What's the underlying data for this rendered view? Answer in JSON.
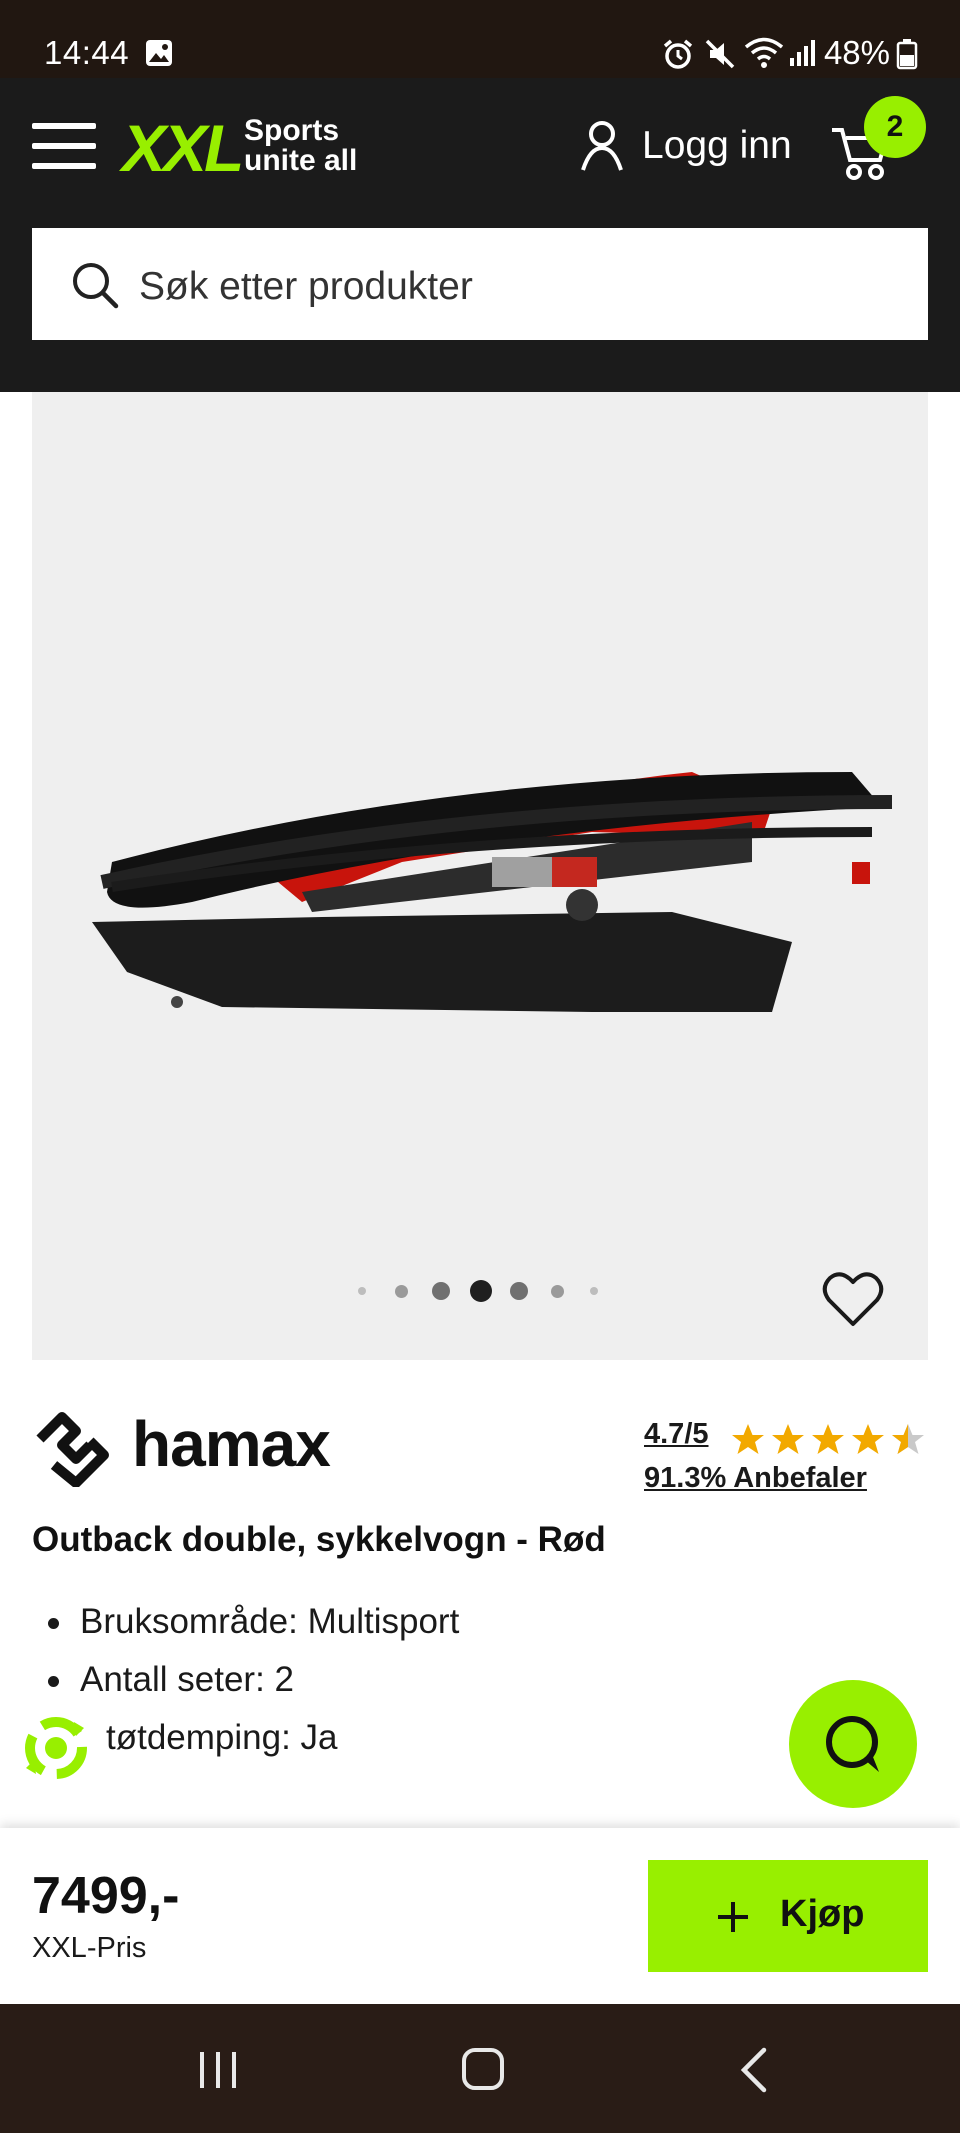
{
  "status_bar": {
    "time": "14:44",
    "battery": "48%",
    "icons": [
      "image-notification-icon",
      "alarm-icon",
      "mute-icon",
      "wifi-icon",
      "signal-icon",
      "battery-icon"
    ]
  },
  "header": {
    "logo_text": "XXL",
    "tagline_line1": "Sports",
    "tagline_line2": "unite all",
    "login_label": "Logg inn",
    "cart_count": "2",
    "search_placeholder": "Søk etter produkter"
  },
  "gallery": {
    "dots_total": 7,
    "active_index": 3
  },
  "product": {
    "brand": "hamax",
    "rating": "4.7/5",
    "rating_stars": 4.7,
    "recommend": "91.3% Anbefaler",
    "title": "Outback double, sykkelvogn - Rød",
    "features": [
      "Bruksområde: Multisport",
      "Antall seter: 2",
      "tøtdemping: Ja"
    ]
  },
  "buy_bar": {
    "price": "7499,-",
    "price_label": "XXL-Pris",
    "buy_label": "Kjøp"
  },
  "colors": {
    "accent": "#98ef00",
    "header_bg": "#1b1b1b",
    "star": "#f2a900"
  }
}
